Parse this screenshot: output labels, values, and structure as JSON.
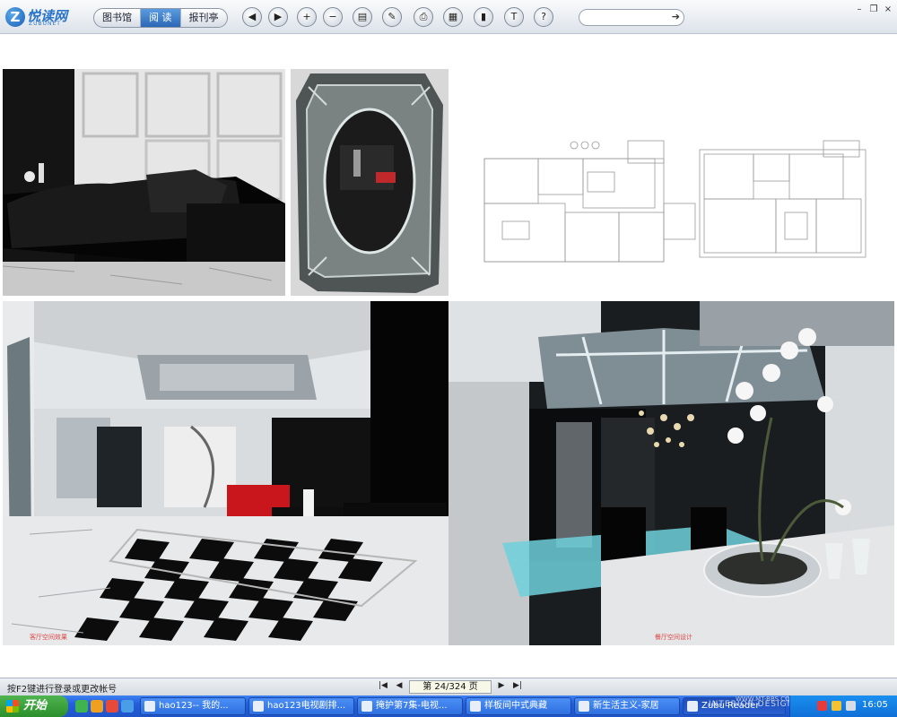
{
  "toolbar": {
    "logo": "Z",
    "logo_text": "悦读网",
    "logo_sub": "ZUBUNET",
    "tabs": [
      {
        "label": "图书馆",
        "active": false
      },
      {
        "label": "阅 读",
        "active": true
      },
      {
        "label": "报刊亭",
        "active": false
      }
    ],
    "buttons": {
      "back": "◀",
      "forward": "▶",
      "zoom_in": "+",
      "zoom_out": "−",
      "book": "▤",
      "annotate": "✎",
      "print": "⎙",
      "layout": "▦",
      "library": "▮",
      "text": "T",
      "help": "?"
    },
    "search_value": "",
    "search_go": "➔",
    "window_controls": {
      "minimize": "–",
      "restore": "❐",
      "close": "×"
    }
  },
  "photos": [
    {
      "name": "living-room-sofa",
      "caption": ""
    },
    {
      "name": "venetian-mirror",
      "caption": ""
    },
    {
      "name": "floor-plans",
      "caption": ""
    },
    {
      "name": "checkered-living-room",
      "caption": "客厅空间效果"
    },
    {
      "name": "dining-room-chandelier",
      "caption": "餐厅空间设计"
    }
  ],
  "statusbar": {
    "message": "按F2键进行登录或更改帐号",
    "first": "|◀",
    "prev": "◀",
    "page_indicator": "第 24/324 页",
    "next": "▶",
    "last": "▶|"
  },
  "taskbar": {
    "start_label": "开始",
    "tasks": [
      {
        "label": "hao123-- 我的...",
        "active": false
      },
      {
        "label": "hao123电视剧排...",
        "active": false
      },
      {
        "label": "掩护第7集-电视...",
        "active": false
      },
      {
        "label": "样板间中式典藏",
        "active": false
      },
      {
        "label": "新生活主义-家居",
        "active": false
      },
      {
        "label": "Zubu Reader",
        "active": true
      }
    ],
    "watermark": "INTERIOR DESIGN",
    "watermark2": "WWW.MT-BBS.COM",
    "clock": "16:05"
  }
}
